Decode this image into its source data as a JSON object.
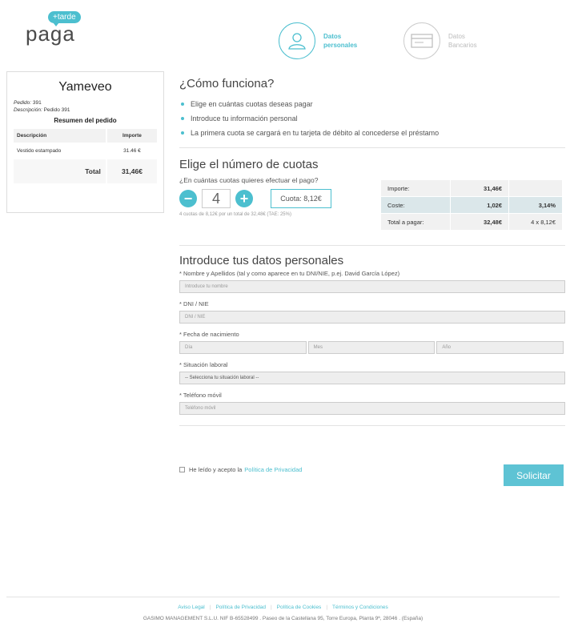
{
  "logo": {
    "badge": "+tarde",
    "word": "paga"
  },
  "steps": [
    {
      "line1": "Datos",
      "line2": "personales",
      "state": "active",
      "icon": "user-icon"
    },
    {
      "line1": "Datos",
      "line2": "Bancarios",
      "state": "inactive",
      "icon": "card-icon"
    }
  ],
  "order": {
    "merchant": "Yameveo",
    "pedido_label": "Pedido:",
    "pedido_value": "391",
    "descripcion_label": "Descripción:",
    "descripcion_value": "Pedido 391",
    "summary_title": "Resumen del pedido",
    "col_desc": "Descripción",
    "col_importe": "Importe",
    "items": [
      {
        "desc": "Vestido estampado",
        "importe": "31.46 €"
      }
    ],
    "total_label": "Total",
    "total_value": "31,46€"
  },
  "howto": {
    "title": "¿Cómo funciona?",
    "bullets": [
      "Elige en cuántas cuotas deseas pagar",
      "Introduce tu información personal",
      "La primera cuota se cargará en tu tarjeta de débito al concederse el préstamo"
    ]
  },
  "cuotas": {
    "title": "Elige el número de cuotas",
    "question": "¿En cuántas cuotas quieres efectuar el pago?",
    "minus": "−",
    "plus": "+",
    "quantity": "4",
    "cuota_text": "Cuota: 8,12€",
    "note": "4 cuotas de 8,12€ por un total de 32,48€ (TAE: 25%)",
    "table": [
      {
        "label": "Importe:",
        "value": "31,46€",
        "extra": ""
      },
      {
        "label": "Coste:",
        "value": "1,02€",
        "extra": "3,14%"
      },
      {
        "label": "Total a pagar:",
        "value": "32,48€",
        "extra": "4 x 8,12€"
      }
    ]
  },
  "personal": {
    "title": "Introduce tus datos personales",
    "name_label": "* Nombre y Apellidos (tal y como aparece en tu DNI/NIE, p.ej. David García López)",
    "name_placeholder": "Introduce tu nombre",
    "dni_label": "* DNI / NIE",
    "dni_placeholder": "DNI / NIE",
    "birth_label": "* Fecha de nacimiento",
    "day_placeholder": "Día",
    "month_placeholder": "Mes",
    "year_placeholder": "Año",
    "work_label": "* Situación laboral",
    "work_selected": "-- Selecciona tu situación laboral --",
    "phone_label": "* Teléfono móvil",
    "phone_placeholder": "Teléfono móvil"
  },
  "accept": {
    "text": "He leído y acepto la",
    "link": "Política de Privacidad"
  },
  "submit_label": "Solicitar",
  "footer": {
    "links": [
      "Aviso Legal",
      "Política de Privacidad",
      "Política de Cookies",
      "Términos y Condiciones"
    ],
    "company": "GASIMO MANAGEMENT S.L.U. NIF B-65528499 . Paseo de la Castellana 95, Torre Europa, Planta 9ª, 28046 . (España)"
  },
  "colors": {
    "accent": "#4cbfcf",
    "highlight_row": "#dbe7ea"
  }
}
